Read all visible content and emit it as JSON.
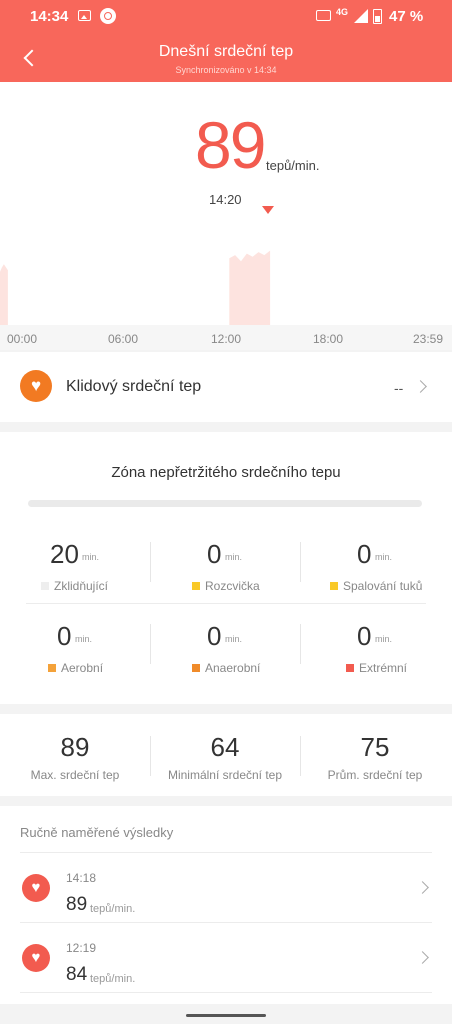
{
  "status_bar": {
    "time": "14:34",
    "network": "4G",
    "battery": "47 %",
    "icons": [
      "image-icon",
      "app-notification-icon",
      "volte-icon",
      "signal-icon",
      "battery-icon"
    ]
  },
  "header": {
    "title": "Dnešní srdeční tep",
    "subtitle": "Synchronizováno v 14:34",
    "back_icon": "chevron-left-icon"
  },
  "current": {
    "value": "89",
    "unit": "tepů/min.",
    "time": "14:20"
  },
  "chart_data": {
    "type": "area",
    "x_ticks": [
      "00:00",
      "06:00",
      "12:00",
      "18:00",
      "23:59"
    ],
    "xlabel": "",
    "ylabel": "",
    "note_color": "#fde3df",
    "segments": [
      {
        "start": "00:00",
        "end": "00:25",
        "values": [
          75,
          78,
          80,
          78,
          76
        ]
      },
      {
        "start": "12:10",
        "end": "14:20",
        "values": [
          84,
          86,
          82,
          87,
          85,
          88,
          86,
          89
        ]
      }
    ]
  },
  "resting": {
    "label": "Klidový srdeční tep",
    "value": "--",
    "icon": "heart-icon"
  },
  "zones": {
    "title": "Zóna nepřetržitého srdečního tepu",
    "unit": "min.",
    "items": [
      {
        "value": "20",
        "label": "Zklidňující",
        "color": "#eeeeee"
      },
      {
        "value": "0",
        "label": "Rozcvička",
        "color": "#f9c928"
      },
      {
        "value": "0",
        "label": "Spalování tuků",
        "color": "#f9c928"
      },
      {
        "value": "0",
        "label": "Aerobní",
        "color": "#f4a23a"
      },
      {
        "value": "0",
        "label": "Anaerobní",
        "color": "#f08b2a"
      },
      {
        "value": "0",
        "label": "Extrémní",
        "color": "#f25b4f"
      }
    ]
  },
  "stats": [
    {
      "value": "89",
      "label": "Max. srdeční tep"
    },
    {
      "value": "64",
      "label": "Minimální srdeční tep"
    },
    {
      "value": "75",
      "label": "Prům. srdeční tep"
    }
  ],
  "manual": {
    "title": "Ručně naměřené výsledky",
    "unit": "tepů/min.",
    "items": [
      {
        "time": "14:18",
        "value": "89"
      },
      {
        "time": "12:19",
        "value": "84"
      }
    ]
  }
}
